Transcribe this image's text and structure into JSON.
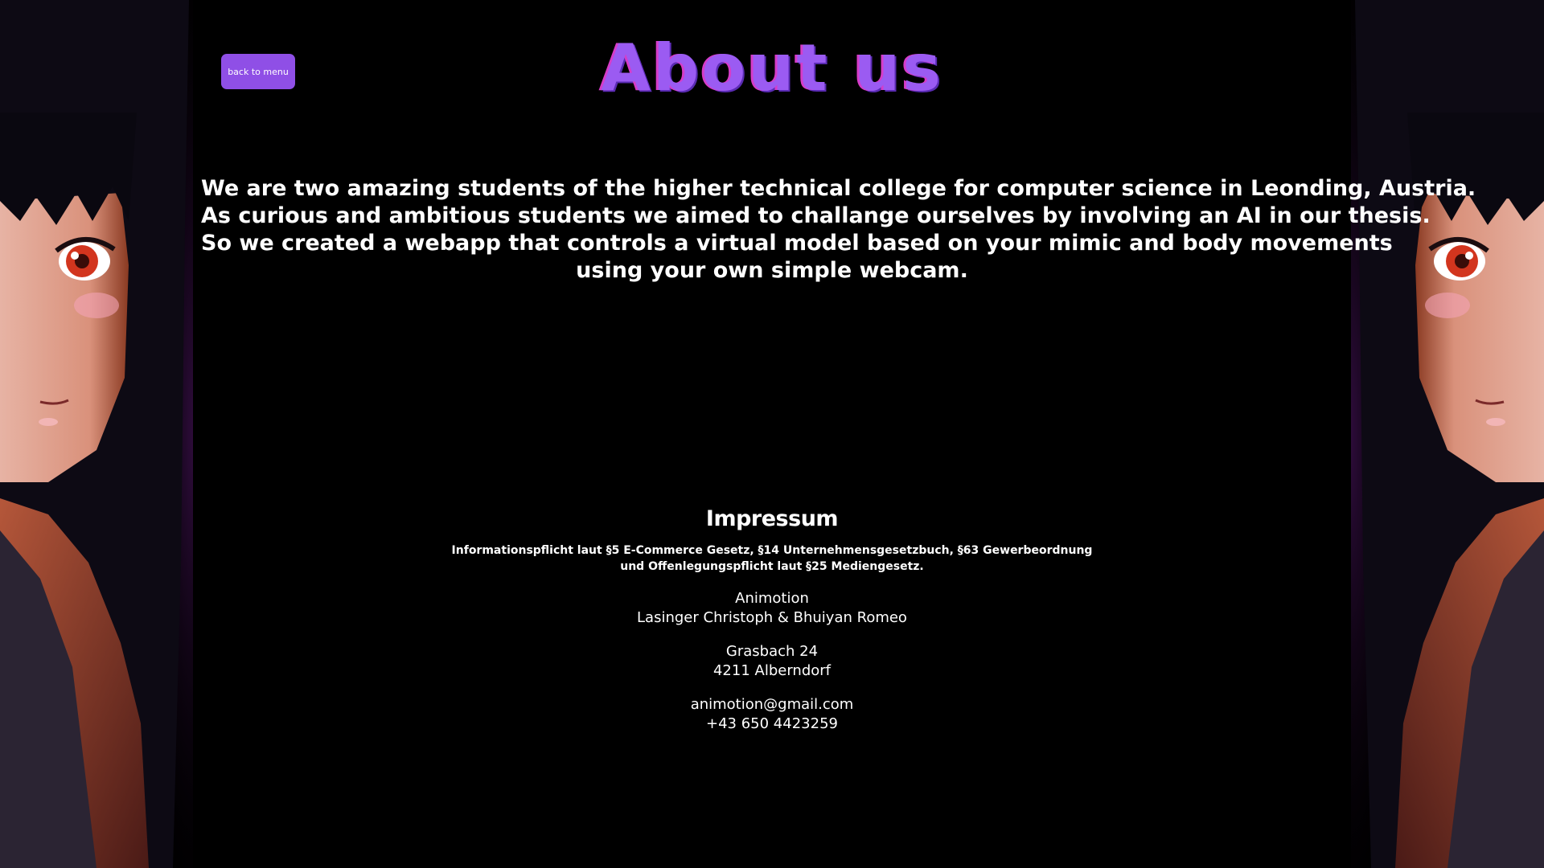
{
  "header": {
    "back_label": "back to menu",
    "title": "About us"
  },
  "intro": {
    "lines": [
      "We are two amazing students of the higher technical college for computer science in Leonding, Austria.",
      "As curious and ambitious students we aimed to challange ourselves by involving an AI in our thesis.",
      "So we created a webapp that controls a virtual model based on your mimic and body movements",
      "using your own simple webcam."
    ]
  },
  "impressum": {
    "heading": "Impressum",
    "legal_lines": [
      "Informationspflicht laut §5 E-Commerce Gesetz, §14 Unternehmensgesetzbuch, §63 Gewerbeordnung",
      "und Offenlegungspflicht laut §25 Mediengesetz."
    ],
    "company": "Animotion",
    "owners": "Lasinger Christoph & Bhuiyan Romeo",
    "street": "Grasbach 24",
    "city": "4211 Alberndorf",
    "email": "animotion@gmail.com",
    "phone": "+43 650 4423259"
  },
  "colors": {
    "accent": "#8f4fe6",
    "title": "#9b5bf2",
    "title_shadow": "#d63cc9",
    "background": "#000000",
    "text": "#ffffff"
  },
  "decor": {
    "left_image": "anime-girl-portrait",
    "right_image": "anime-girl-portrait-mirrored"
  }
}
